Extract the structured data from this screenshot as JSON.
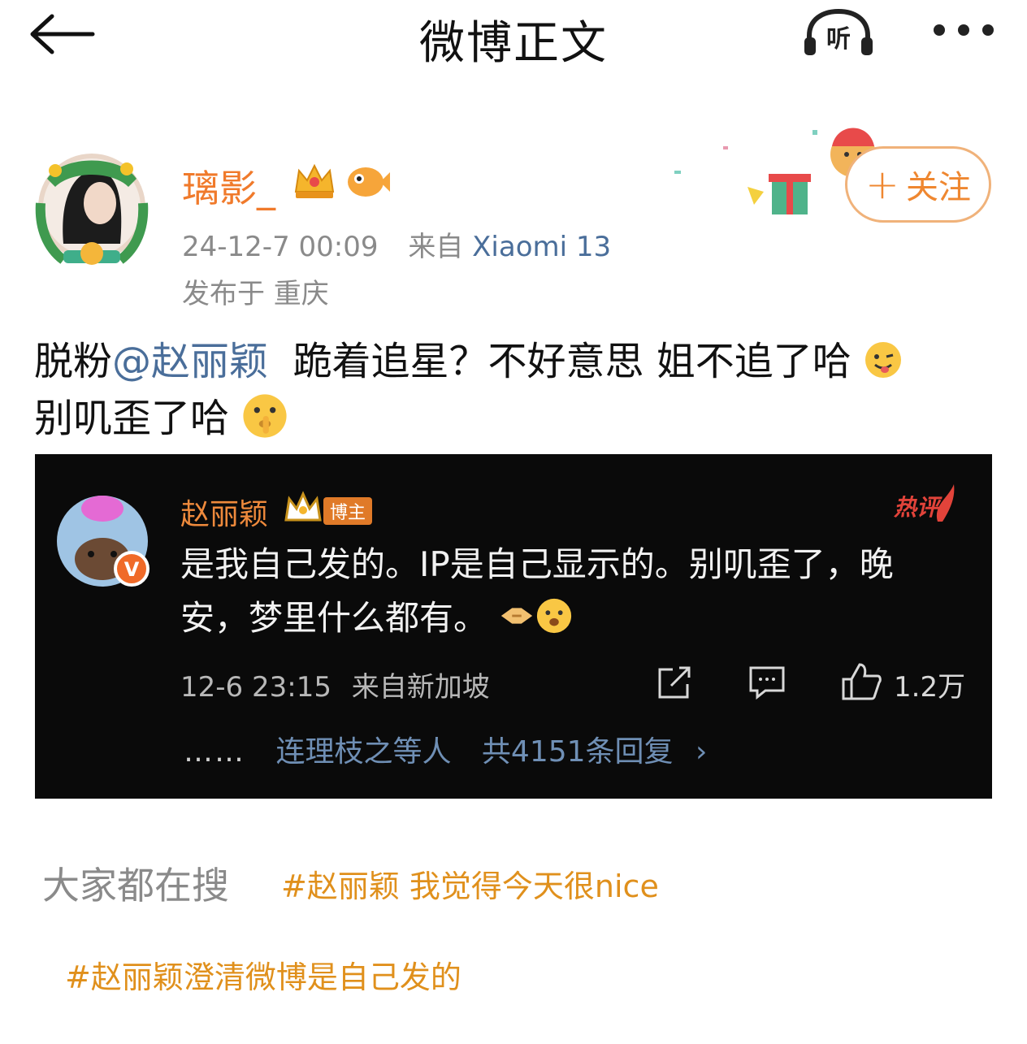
{
  "header": {
    "title": "微博正文",
    "listen_label": "听"
  },
  "author": {
    "name": "璃影_",
    "date": "24-12-7 00:09",
    "source_prefix": "来自",
    "device": "Xiaomi 13",
    "location": "发布于 重庆",
    "follow_label": "关注",
    "follow_plus": "+"
  },
  "post": {
    "text_before": "脱粉",
    "mention": "@赵丽颖",
    "text_after": "  跪着追星？不好意思 姐不追了哈",
    "line2": "别叽歪了哈"
  },
  "comment": {
    "name": "赵丽颖",
    "role_badge": "博主",
    "hot_tag": "热评",
    "text": "是我自己发的。IP是自己显示的。别叽歪了，晚安，梦里什么都有。",
    "time": "12-6 23:15",
    "source": "来自新加坡",
    "likes": "1.2万",
    "reply_dots": "……",
    "reply_users": "连理枝之等人",
    "reply_count": "共4151条回复",
    "reply_chevron": "›"
  },
  "search": {
    "label": "大家都在搜",
    "tags": [
      "#赵丽颖 我觉得今天很nice",
      "#赵丽颖澄清微博是自己发的"
    ]
  },
  "colors": {
    "accent_orange": "#f07a2b",
    "link_blue": "#4a6e9a",
    "card_bg": "#0a0a0a",
    "tag_gold": "#e0901c"
  }
}
